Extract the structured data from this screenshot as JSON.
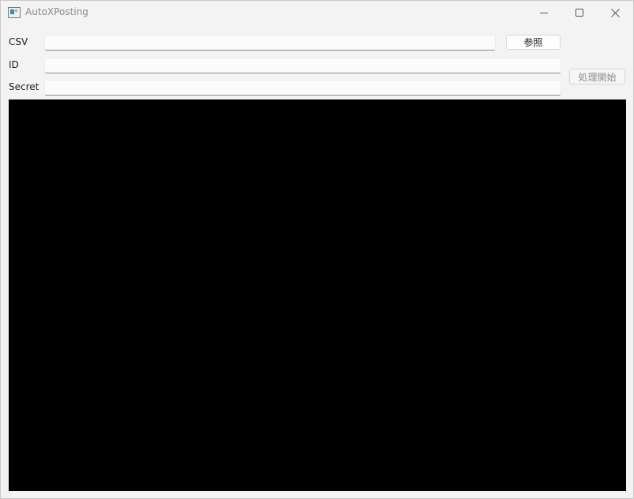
{
  "window": {
    "title": "AutoXPosting"
  },
  "form": {
    "csv_label": "CSV",
    "csv_value": "",
    "browse_label": "参照",
    "id_label": "ID",
    "id_value": "",
    "secret_label": "Secret",
    "secret_value": "",
    "start_label": "処理開始"
  },
  "log": {
    "text": ""
  },
  "icons": {
    "app": "app-window-icon",
    "minimize": "minimize-icon",
    "maximize": "maximize-icon",
    "close": "close-icon"
  },
  "colors": {
    "log_background": "#000000",
    "window_background": "#f3f3f3",
    "disabled_text": "#8a8a8a"
  }
}
